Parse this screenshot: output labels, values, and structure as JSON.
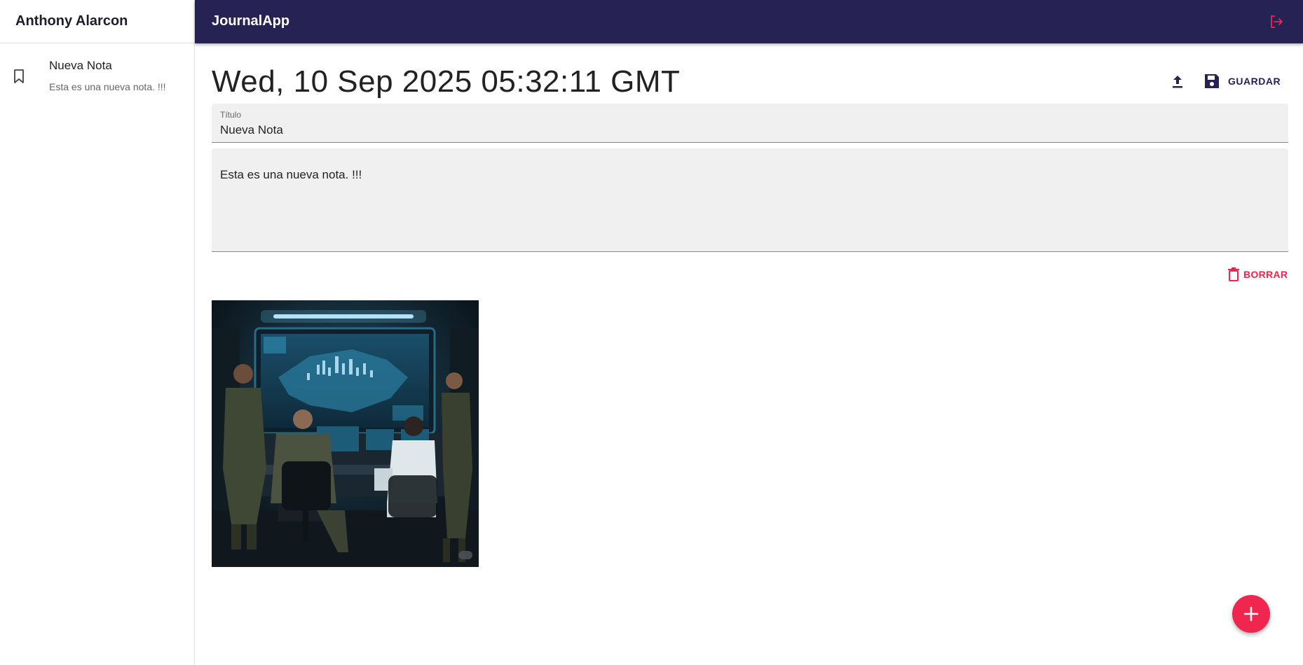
{
  "sidebar": {
    "user_name": "Anthony Alarcon",
    "notes": [
      {
        "title": "Nueva Nota",
        "body": "Esta es una nueva nota. !!!"
      }
    ]
  },
  "topbar": {
    "app_title": "JournalApp"
  },
  "note": {
    "date": "Wed, 10 Sep 2025 05:32:11 GMT",
    "title_label": "Título",
    "title_value": "Nueva Nota",
    "body_value": "Esta es una nueva nota. !!!",
    "save_label": "GUARDAR",
    "delete_label": "BORRAR",
    "image_watermark": "ai"
  },
  "colors": {
    "primary": "#262254",
    "accent": "#f0264e",
    "field_bg": "#f0f0f0"
  },
  "icons": [
    "bookmark-icon",
    "logout-icon",
    "upload-icon",
    "save-icon",
    "trash-icon",
    "plus-icon"
  ]
}
